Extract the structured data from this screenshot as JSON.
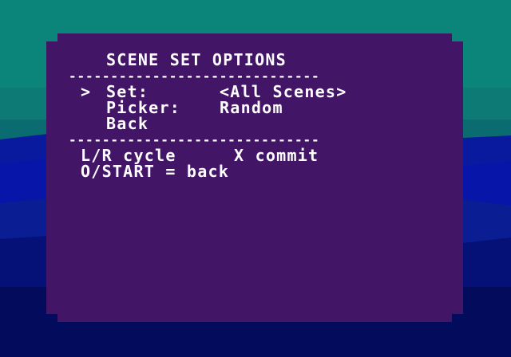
{
  "menu": {
    "title": "SCENE SET OPTIONS",
    "separator": "------------------------------",
    "cursor": ">",
    "items": [
      {
        "label": "Set:",
        "value": "<All Scenes>",
        "selected": true
      },
      {
        "label": "Picker:",
        "value": "Random",
        "selected": false
      },
      {
        "label": "Back",
        "value": "",
        "selected": false
      }
    ]
  },
  "help": {
    "line1_a": "L/R cycle",
    "line1_b": "X commit",
    "line2": "O/START = back"
  },
  "colors": {
    "panel": "#431566",
    "text": "#ffffff",
    "sky": "#0b8479",
    "ocean": "#01084f"
  }
}
